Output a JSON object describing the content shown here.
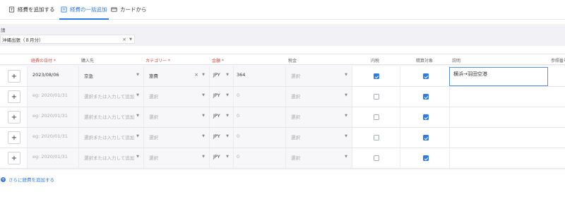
{
  "tabs": [
    {
      "label": "経費を追加する",
      "icon": "receipt-icon",
      "active": false
    },
    {
      "label": "経費の一括追加",
      "icon": "bulk-list-icon",
      "active": true
    },
    {
      "label": "カードから",
      "icon": "credit-card-icon",
      "active": false
    }
  ],
  "report": {
    "label": "請",
    "value": "沖縄出張（８月分）"
  },
  "columns": {
    "date": "経費の日付",
    "vendor": "購入先",
    "category": "カテゴリー",
    "amount": "金額",
    "tax": "税金",
    "tax_included": "内税",
    "reimbursable": "精算対象",
    "description": "説明",
    "reference": "参照番号"
  },
  "rows": [
    {
      "date": "2023/08/06",
      "vendor": "京急",
      "category": "旅費",
      "currency": "JPY",
      "amount": "364",
      "tax": "選択",
      "tax_included": true,
      "reimbursable": true,
      "description": "横浜→羽田空港"
    },
    {
      "date": "eg: 2020/01/31",
      "vendor": "選択または入力して追加",
      "category": "選択",
      "currency": "JPY",
      "amount": "0",
      "tax": "選択",
      "tax_included": false,
      "reimbursable": true,
      "description": ""
    },
    {
      "date": "eg: 2020/01/31",
      "vendor": "選択または入力して追加",
      "category": "選択",
      "currency": "JPY",
      "amount": "0",
      "tax": "選択",
      "tax_included": false,
      "reimbursable": true,
      "description": ""
    },
    {
      "date": "eg: 2020/01/31",
      "vendor": "選択または入力して追加",
      "category": "選択",
      "currency": "JPY",
      "amount": "0",
      "tax": "選択",
      "tax_included": false,
      "reimbursable": true,
      "description": ""
    },
    {
      "date": "eg: 2020/01/31",
      "vendor": "選択または入力して追加",
      "category": "選択",
      "currency": "JPY",
      "amount": "0",
      "tax": "選択",
      "tax_included": false,
      "reimbursable": true,
      "description": ""
    }
  ],
  "add_more_label": "さらに経費を追加する",
  "colors": {
    "accent": "#2f7be5",
    "required": "#d9453b"
  }
}
